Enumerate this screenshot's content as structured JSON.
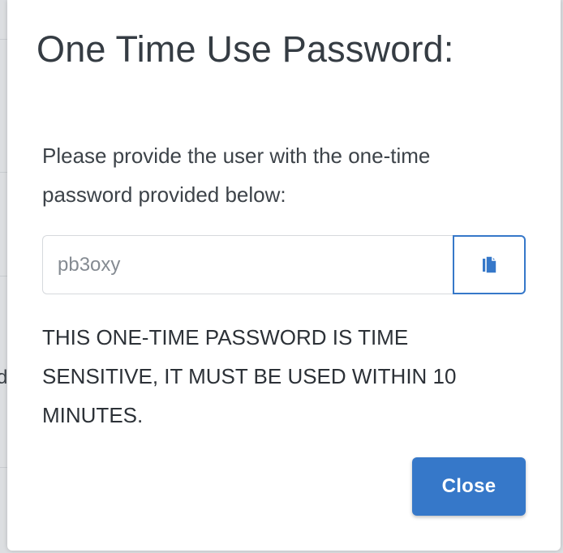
{
  "modal": {
    "title": "One Time Use Password:",
    "instructions": "Please provide the user with the one-time password provided below:",
    "otp_value": "pb3oxy",
    "copy_icon": "copy-icon",
    "warning": "THIS ONE-TIME PASSWORD IS TIME SENSITIVE, IT MUST BE USED WITHIN 10 MINUTES.",
    "close_label": "Close"
  },
  "background": {
    "partial_text": "d"
  },
  "colors": {
    "primary": "#3678c9",
    "text": "#353c43",
    "input_border": "#d6d9dd",
    "placeholder_text": "#858b92"
  }
}
